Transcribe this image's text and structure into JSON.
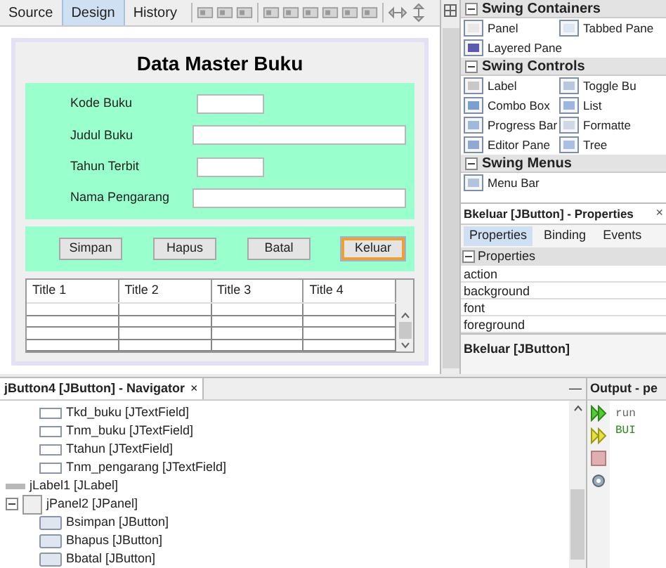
{
  "editor_tabs": [
    {
      "label": "Source",
      "selected": false
    },
    {
      "label": "Design",
      "selected": true
    },
    {
      "label": "History",
      "selected": false
    }
  ],
  "form": {
    "title": "Data Master Buku",
    "fields": [
      {
        "label": "Kode Buku",
        "kind": "short"
      },
      {
        "label": "Judul Buku",
        "kind": "long"
      },
      {
        "label": "Tahun Terbit",
        "kind": "short"
      },
      {
        "label": "Nama Pengarang",
        "kind": "long"
      }
    ],
    "buttons": [
      {
        "label": "Simpan",
        "selected": false
      },
      {
        "label": "Hapus",
        "selected": false
      },
      {
        "label": "Batal",
        "selected": false
      },
      {
        "label": "Keluar",
        "selected": true
      }
    ],
    "table": {
      "columns": [
        "Title 1",
        "Title 2",
        "Title 3",
        "Title 4"
      ]
    }
  },
  "palette": {
    "sections": [
      {
        "title": "Swing Containers",
        "expanded": true,
        "items": [
          {
            "label": "Panel",
            "kind": "panel"
          },
          {
            "label": "Tabbed Pane",
            "kind": "tabbed"
          },
          {
            "label": "Layered Pane",
            "kind": "layered"
          }
        ]
      },
      {
        "title": "Swing Controls",
        "expanded": true,
        "items": [
          {
            "label": "Label",
            "kind": "label"
          },
          {
            "label": "Toggle Bu",
            "kind": "toggle"
          },
          {
            "label": "Combo Box",
            "kind": "combo"
          },
          {
            "label": "List",
            "kind": "list"
          },
          {
            "label": "Progress Bar",
            "kind": "progress"
          },
          {
            "label": "Formatte",
            "kind": "formatted"
          },
          {
            "label": "Editor Pane",
            "kind": "editor"
          },
          {
            "label": "Tree",
            "kind": "tree"
          }
        ]
      },
      {
        "title": "Swing Menus",
        "expanded": true,
        "items": [
          {
            "label": "Menu Bar",
            "kind": "menubar"
          }
        ]
      }
    ]
  },
  "properties": {
    "title": "Bkeluar [JButton] - Properties",
    "close": "×",
    "tabs": [
      {
        "label": "Properties",
        "selected": true
      },
      {
        "label": "Binding",
        "selected": false
      },
      {
        "label": "Events",
        "selected": false
      }
    ],
    "section": {
      "title": "Properties",
      "expanded": true
    },
    "rows": [
      "action",
      "background",
      "font",
      "foreground"
    ],
    "description": "Bkeluar [JButton]"
  },
  "navigator": {
    "title": "jButton4 [JButton] - Navigator",
    "close": "×",
    "minimize": "—",
    "tree": [
      {
        "children": [
          {
            "label": "Tkd_buku [JTextField]",
            "kind": "textfield"
          },
          {
            "label": "Tnm_buku [JTextField]",
            "kind": "textfield"
          },
          {
            "label": "Ttahun [JTextField]",
            "kind": "textfield"
          },
          {
            "label": "Tnm_pengarang [JTextField]",
            "kind": "textfield"
          }
        ]
      },
      {
        "label": "jLabel1 [JLabel]",
        "kind": "label"
      },
      {
        "label": "jPanel2 [JPanel]",
        "kind": "panel",
        "expanded": true,
        "children": [
          {
            "label": "Bsimpan [JButton]",
            "kind": "button"
          },
          {
            "label": "Bhapus [JButton]",
            "kind": "button"
          },
          {
            "label": "Bbatal [JButton]",
            "kind": "button"
          }
        ]
      }
    ]
  },
  "output": {
    "title": "Output - pe",
    "lines": [
      "run",
      "BUI"
    ]
  }
}
